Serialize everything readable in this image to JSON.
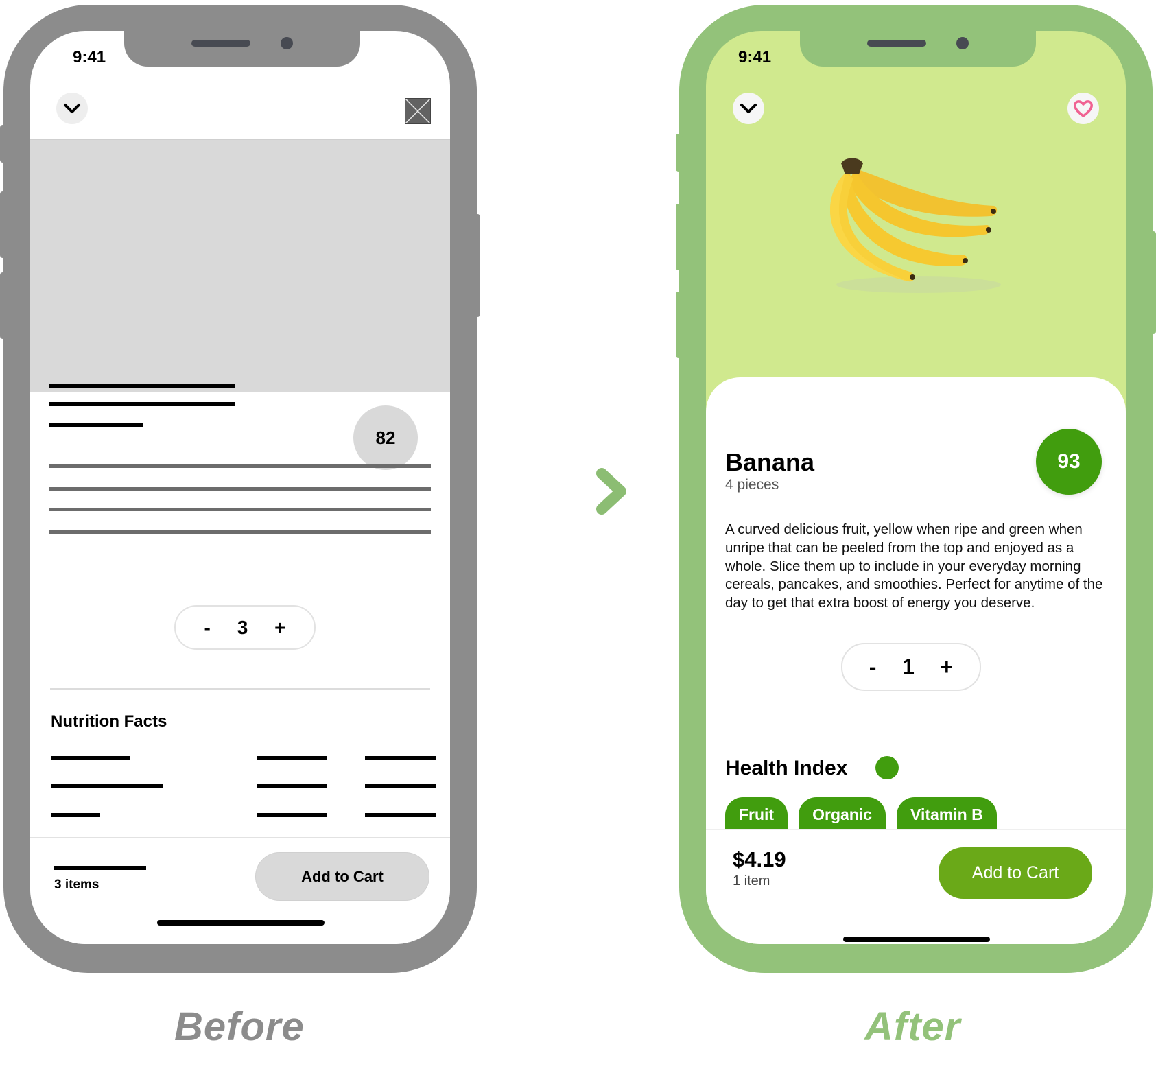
{
  "comparison": {
    "before_label": "Before",
    "after_label": "After",
    "arrow_icon": "arrow-right-icon"
  },
  "colors": {
    "before_frame": "#8c8c8c",
    "after_frame": "#93c27a",
    "after_screen_bg": "#d0e98e",
    "accent_green": "#419d0e",
    "cart_button_green": "#6aa918",
    "heart_pink": "#f06292",
    "wireframe_gray": "#d9d9d9"
  },
  "before": {
    "status_time": "9:41",
    "collapse_icon": "chevron-down-icon",
    "placeholder_icon": "image-placeholder-icon",
    "score": "82",
    "quantity": {
      "minus": "-",
      "value": "3",
      "plus": "+"
    },
    "nutrition_title": "Nutrition Facts",
    "items_count": "3 items",
    "cart_button": "Add to Cart"
  },
  "after": {
    "status_time": "9:41",
    "collapse_icon": "chevron-down-icon",
    "favorite_icon": "heart-icon",
    "product": {
      "name": "Banana",
      "quantity": "4 pieces",
      "score": "93",
      "description": "A curved delicious fruit, yellow when ripe and green when unripe that can be peeled from the top and enjoyed as a whole. Slice them up to include in your everyday morning cereals, pancakes, and smoothies. Perfect for anytime of the day to get that extra boost of energy you deserve.",
      "image": "banana-bunch-image"
    },
    "quantity": {
      "minus": "-",
      "value": "1",
      "plus": "+"
    },
    "health_index_title": "Health Index",
    "tags": [
      {
        "label": "Fruit"
      },
      {
        "label": "Organic"
      },
      {
        "label": "Vitamin B"
      }
    ],
    "price": "$4.19",
    "items_count": "1 item",
    "cart_button": "Add to Cart"
  }
}
